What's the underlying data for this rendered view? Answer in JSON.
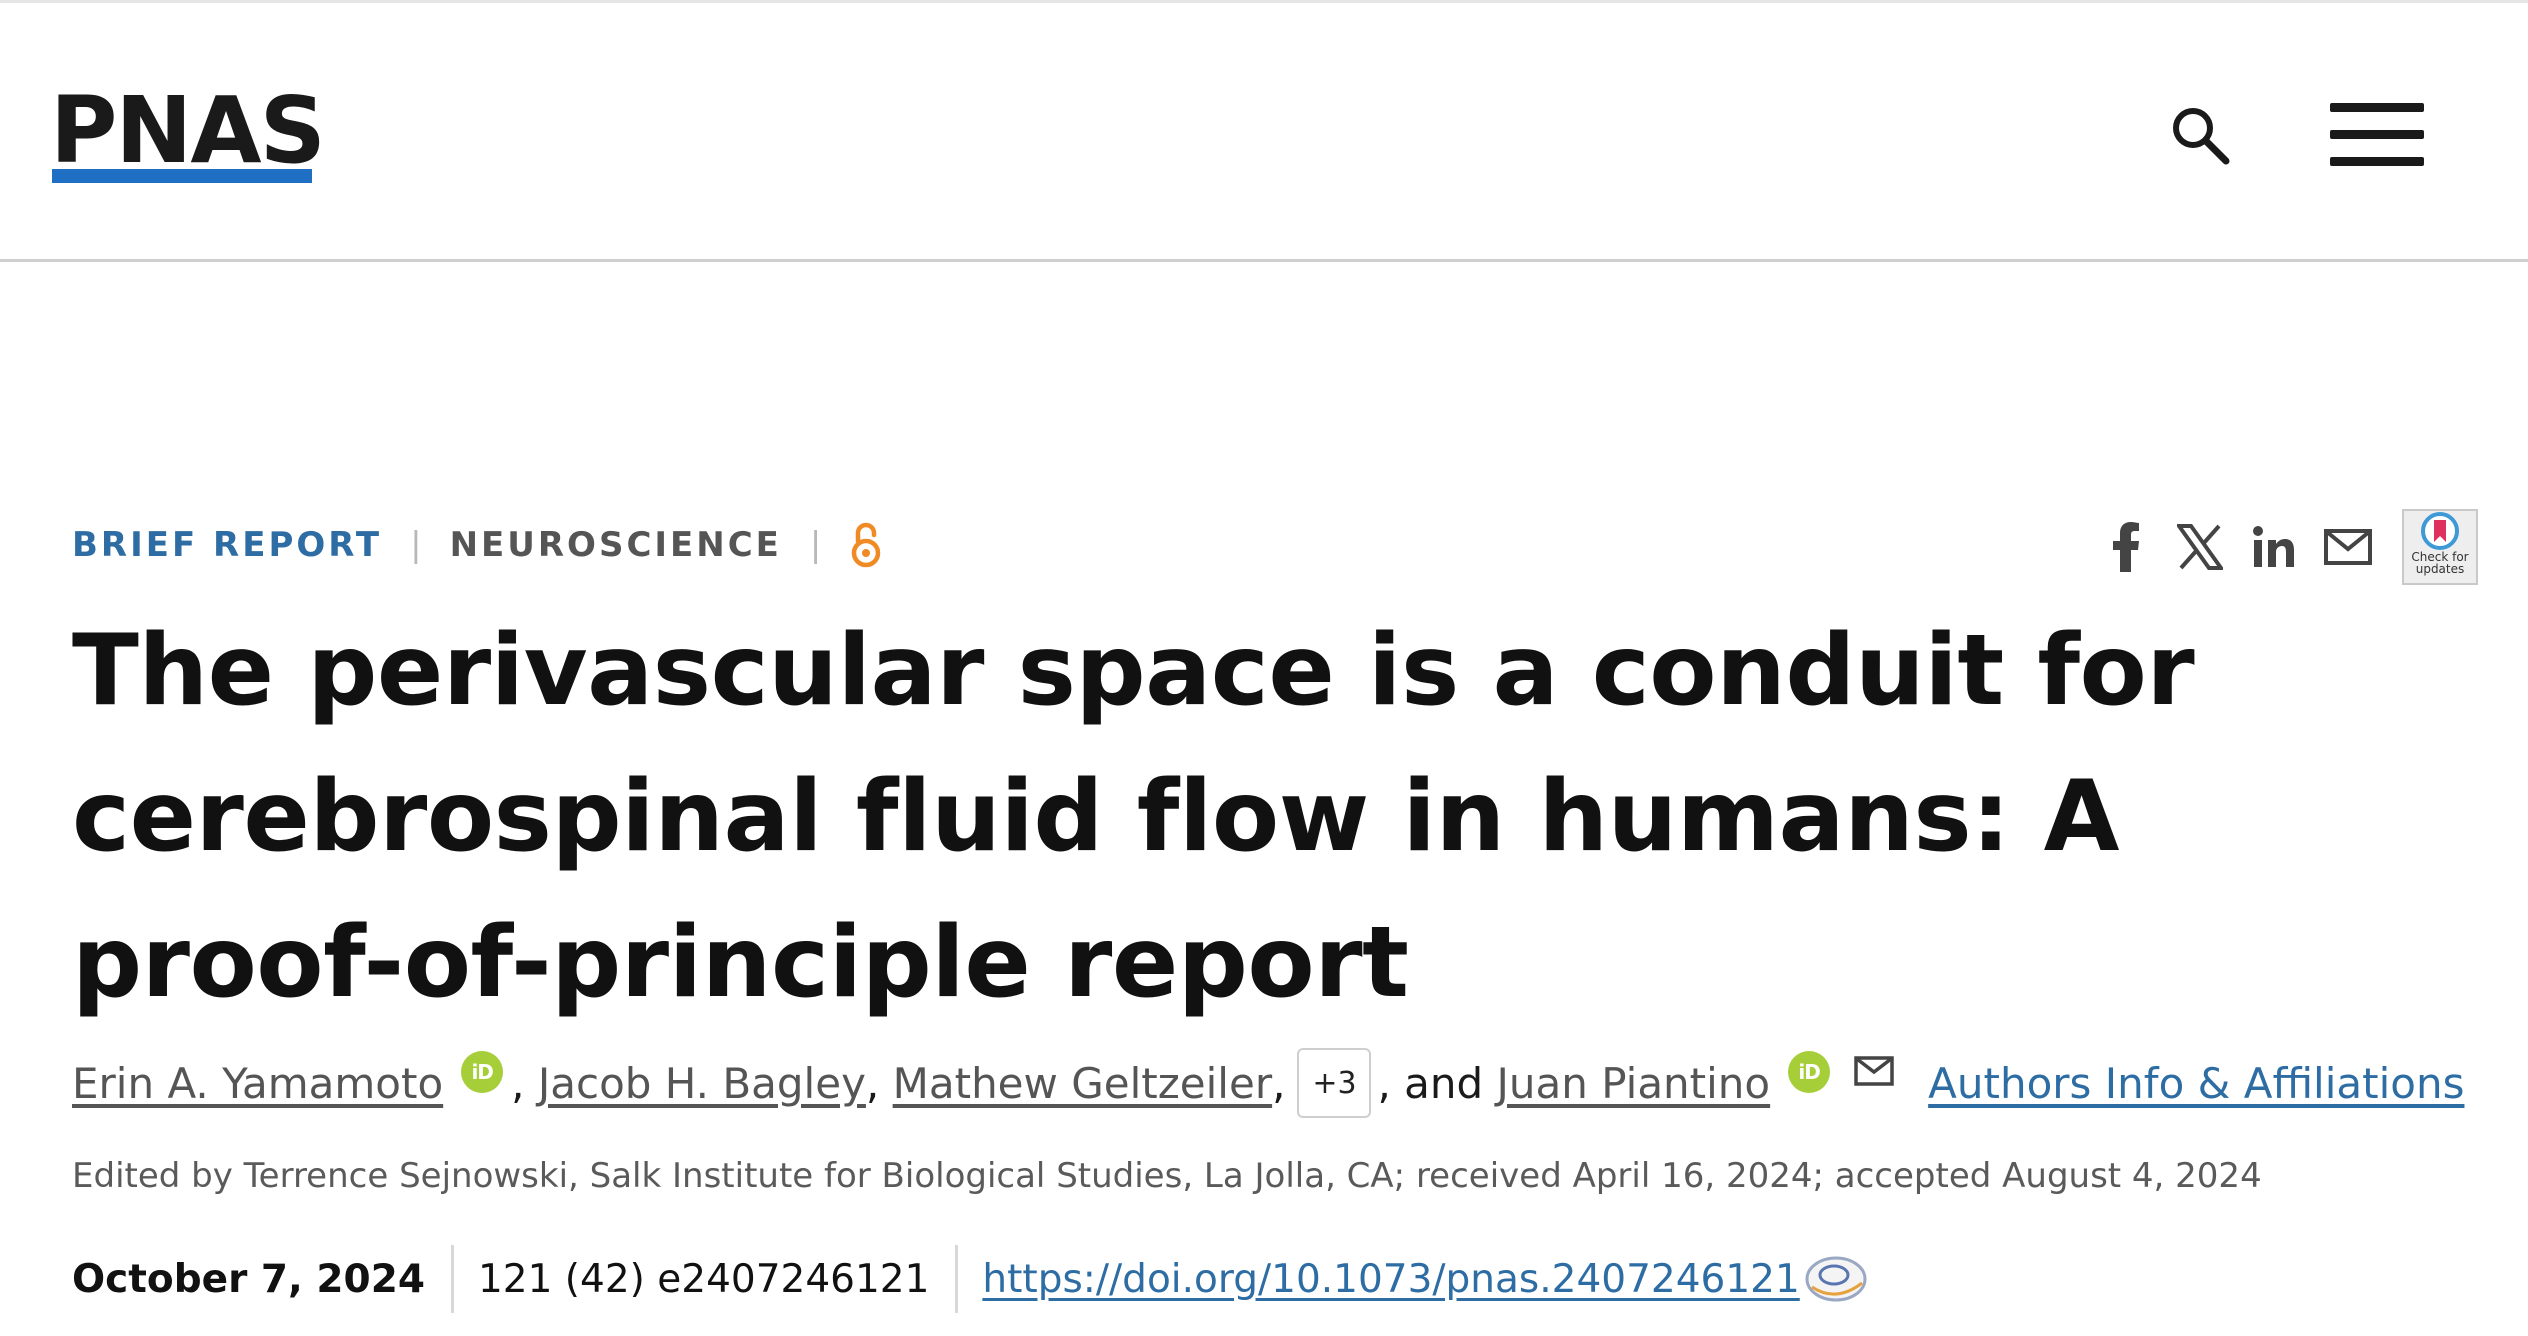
{
  "header": {
    "logo_text": "PNAS",
    "brand_color": "#1f6fc5",
    "search_icon": "search-icon",
    "menu_icon": "hamburger-menu-icon"
  },
  "article": {
    "type": "BRIEF REPORT",
    "category": "NEUROSCIENCE",
    "open_access_icon": "open-access-icon",
    "title": "The perivascular space is a conduit for cerebrospinal fluid flow in humans: A proof-of-principle report",
    "authors": [
      {
        "name": "Erin A. Yamamoto",
        "orcid_label": "iD"
      },
      {
        "name": "Jacob H. Bagley"
      },
      {
        "name": "Mathew Geltzeiler"
      },
      {
        "name": "Juan Piantino",
        "orcid_label": "iD"
      }
    ],
    "more_authors_label": "+3",
    "and_text": ", and",
    "affiliations_link": "Authors Info & Affiliations",
    "edited_line": "Edited by Terrence Sejnowski, Salk Institute for Biological Studies, La Jolla, CA; received April 16, 2024; accepted August 4, 2024",
    "pub_date": "October 7, 2024",
    "citation": "121 (42) e2407246121",
    "doi": "https://doi.org/10.1073/pnas.2407246121"
  },
  "share": {
    "icons": [
      "facebook-icon",
      "x-twitter-icon",
      "linkedin-icon",
      "email-icon"
    ],
    "check_updates_line1": "Check for",
    "check_updates_line2": "updates"
  },
  "colors": {
    "link": "#2e6da4",
    "orcid": "#a6ce39",
    "open_access": "#f08a24"
  }
}
